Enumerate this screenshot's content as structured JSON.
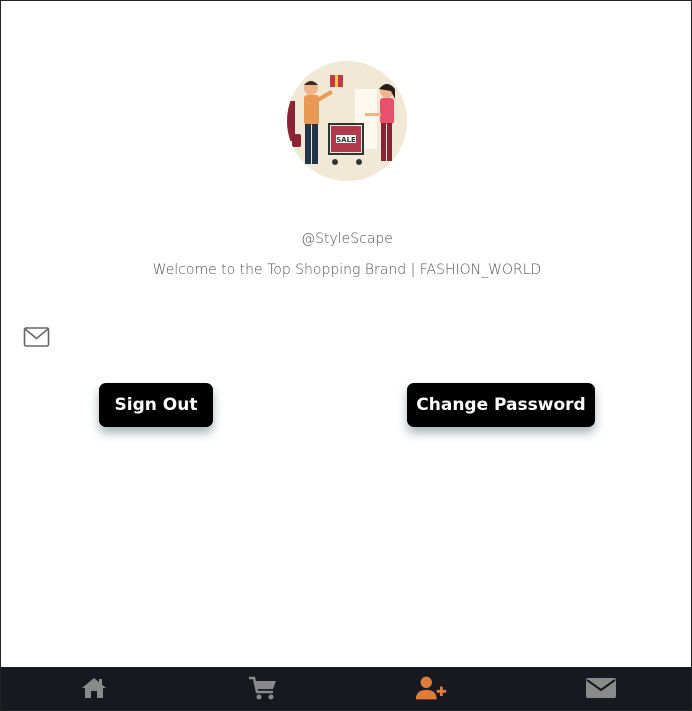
{
  "profile": {
    "username": "@StyleScape",
    "welcome": "Welcome to the Top Shopping Brand | FASHION_WORLD",
    "avatar_sign": "SALE"
  },
  "actions": {
    "sign_out_label": "Sign Out",
    "change_password_label": "Change Password"
  },
  "bottom_nav": {
    "items": [
      {
        "icon": "home-icon",
        "active": false
      },
      {
        "icon": "cart-icon",
        "active": false
      },
      {
        "icon": "user-plus-icon",
        "active": true
      },
      {
        "icon": "envelope-icon",
        "active": false
      }
    ],
    "active_color": "#e07b39",
    "inactive_color": "#8a8a8a"
  }
}
